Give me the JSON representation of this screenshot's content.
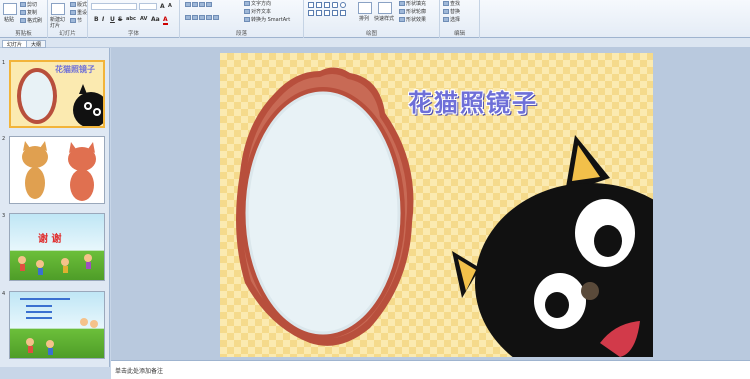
{
  "ribbon": {
    "clipboard": {
      "paste": "粘贴",
      "cut": "剪切",
      "copy": "复制",
      "format_painter": "格式刷",
      "label": "剪贴板"
    },
    "slides": {
      "new_slide": "新建幻灯片",
      "layout": "版式",
      "reset": "重设",
      "section": "节",
      "label": "幻灯片"
    },
    "font": {
      "label": "字体",
      "bold": "B",
      "italic": "I",
      "underline": "U",
      "strikethrough": "S",
      "shadow": "abc",
      "spacing": "AV",
      "case": "Aa",
      "color": "A"
    },
    "paragraph": {
      "label": "段落",
      "text_direction": "文字方向",
      "align_text": "对齐文本",
      "smartart": "转换为 SmartArt"
    },
    "drawing": {
      "label": "绘图",
      "arrange": "排列",
      "quick_styles": "快速样式",
      "shape_fill": "形状填充",
      "shape_outline": "形状轮廓",
      "shape_effects": "形状效果"
    },
    "editing": {
      "label": "编辑",
      "find": "查找",
      "replace": "替换",
      "select": "选择"
    }
  },
  "pane": {
    "tabs": [
      "幻灯片",
      "大纲"
    ],
    "slides": [
      {
        "num": "1",
        "title": "花猫照镜子"
      },
      {
        "num": "2"
      },
      {
        "num": "3",
        "title": "谢 谢"
      },
      {
        "num": "4"
      }
    ]
  },
  "slide": {
    "title": "花猫照镜子"
  },
  "notes": {
    "placeholder": "单击此处添加备注"
  },
  "colors": {
    "accent": "#6e6fd8",
    "mirror_frame": "#b84f3c",
    "mirror_glass": "#e8f2f6",
    "cat": "#111111",
    "slide_bg": "#fbeab0"
  }
}
